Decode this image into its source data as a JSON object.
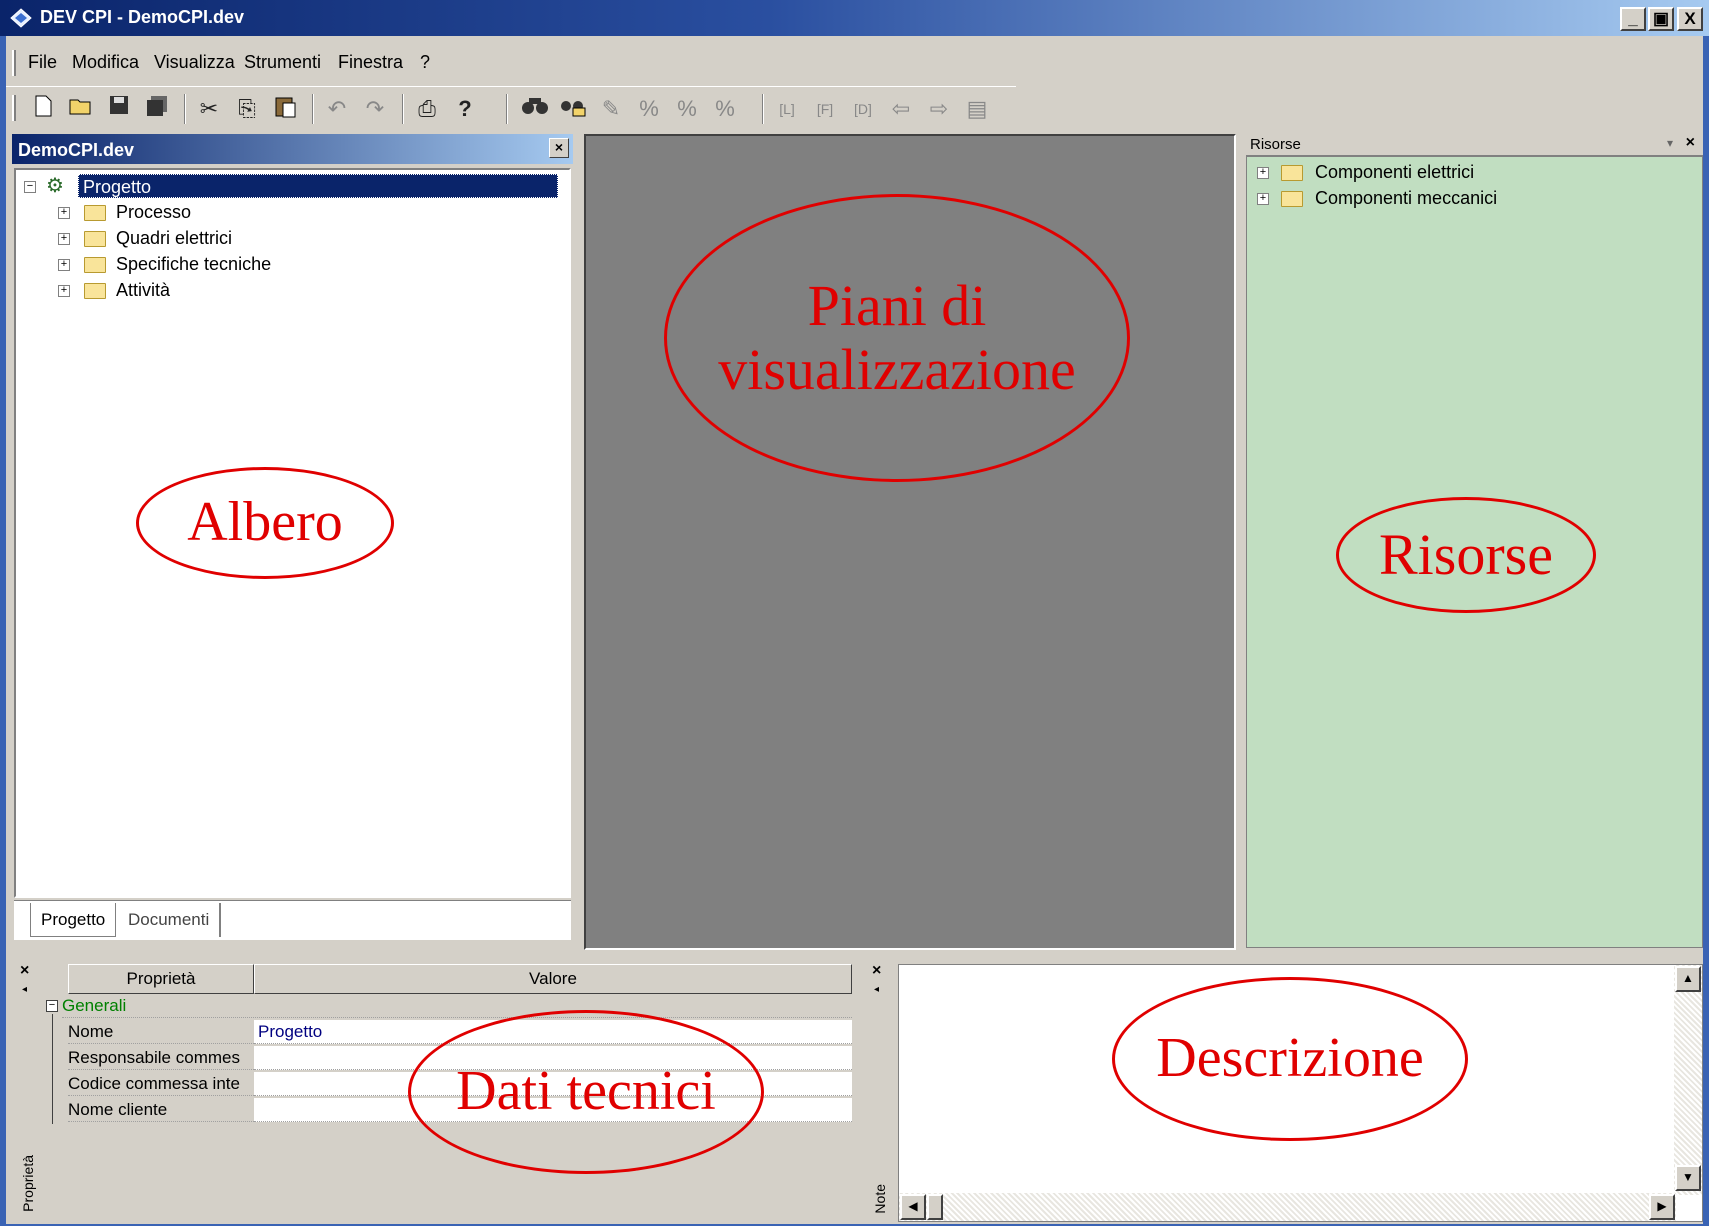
{
  "window": {
    "title": "DEV CPI - DemoCPI.dev",
    "controls": {
      "minimize": "_",
      "restore": "▣",
      "close": "X"
    }
  },
  "menu": [
    "File",
    "Modifica",
    "Visualizza",
    "Strumenti",
    "Finestra",
    "?"
  ],
  "toolbar": {
    "icons": [
      "new-document-icon",
      "open-folder-icon",
      "save-icon",
      "save-all-icon",
      "cut-icon",
      "copy-icon",
      "paste-icon",
      "undo-icon",
      "redo-icon",
      "print-icon",
      "help-icon",
      "find-icon",
      "find-replace-icon",
      "tool-a-icon",
      "tool-b-icon",
      "tool-c-icon",
      "tool-d-icon",
      "l-icon",
      "f-icon",
      "d-icon",
      "back-icon",
      "forward-icon",
      "properties-icon"
    ]
  },
  "tree_panel": {
    "title": "DemoCPI.dev",
    "root": "Progetto",
    "children": [
      "Processo",
      "Quadri elettrici",
      "Specifiche tecniche",
      "Attività"
    ],
    "tabs": [
      "Progetto",
      "Documenti"
    ]
  },
  "resources_panel": {
    "title": "Risorse",
    "items": [
      "Componenti elettrici",
      "Componenti meccanici"
    ]
  },
  "properties_panel": {
    "side_label": "Proprietà",
    "headers": [
      "Proprietà",
      "Valore"
    ],
    "group": "Generali",
    "rows": [
      {
        "name": "Nome",
        "value": "Progetto"
      },
      {
        "name": "Responsabile commes",
        "value": ""
      },
      {
        "name": "Codice commessa inte",
        "value": ""
      },
      {
        "name": "Nome cliente",
        "value": ""
      }
    ]
  },
  "notes_panel": {
    "side_label": "Note"
  },
  "annotations": {
    "albero": "Albero",
    "piani": "Piani di visualizzazione",
    "risorse": "Risorse",
    "dati": "Dati tecnici",
    "descrizione": "Descrizione"
  },
  "colors": {
    "annotation": "#e00000",
    "title_bar": "#0a246a",
    "resources_bg": "#c1dec1",
    "view_bg": "#808080",
    "group_text": "#008000",
    "value_text": "#000080"
  }
}
